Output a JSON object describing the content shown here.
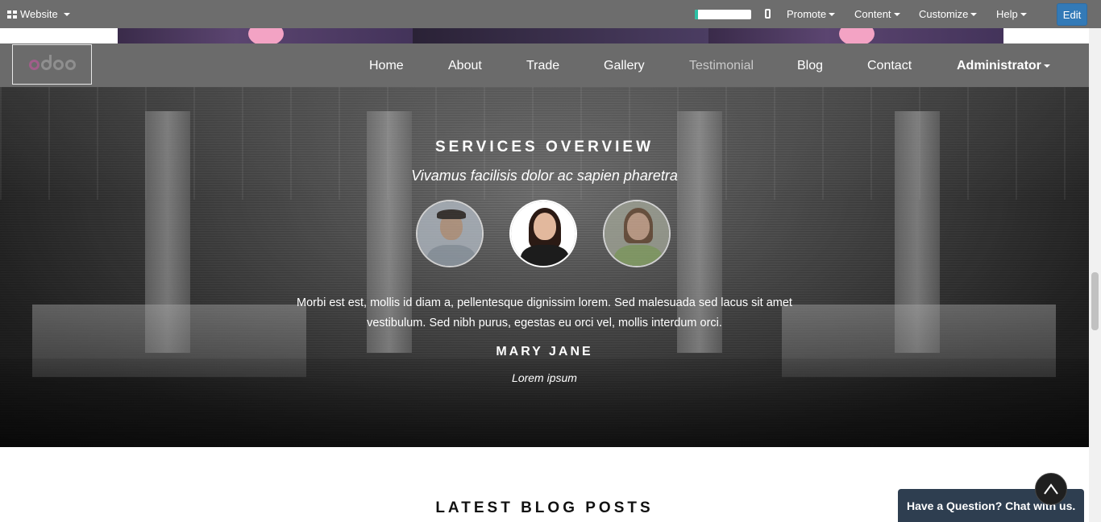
{
  "adminbar": {
    "website_label": "Website",
    "progress_fraction": 0.05,
    "menus": [
      "Promote",
      "Content",
      "Customize",
      "Help"
    ],
    "edit_label": "Edit",
    "edit_color": "#337ab7"
  },
  "navbar": {
    "logo_text": "odoo",
    "items": [
      "Home",
      "About",
      "Trade",
      "Gallery",
      "Testimonial",
      "Blog",
      "Contact"
    ],
    "active_item": "Testimonial",
    "user_label": "Administrator"
  },
  "testimonial": {
    "title": "SERVICES OVERVIEW",
    "subtitle": "Vivamus facilisis dolor ac sapien pharetra",
    "avatars": [
      "avatar-man",
      "avatar-woman-glasses",
      "avatar-woman-green"
    ],
    "quote": "Morbi est est, mollis id diam a, pellentesque dignissim lorem. Sed malesuada sed lacus sit amet vestibulum. Sed nibh purus, egestas eu orci vel, mollis interdum orci.",
    "name": "MARY JANE",
    "role": "Lorem ipsum"
  },
  "blog": {
    "title": "LATEST BLOG POSTS"
  },
  "chat": {
    "label": "Have a Question? Chat with us."
  },
  "icons": {
    "apps": "grid-icon",
    "mobile": "mobile-icon",
    "scroll_top": "arrow-up-icon"
  },
  "colors": {
    "navbar_bg": "#6b6b6b",
    "chat_bg": "#2e3e50",
    "progress_fill": "#2bbfa4"
  }
}
